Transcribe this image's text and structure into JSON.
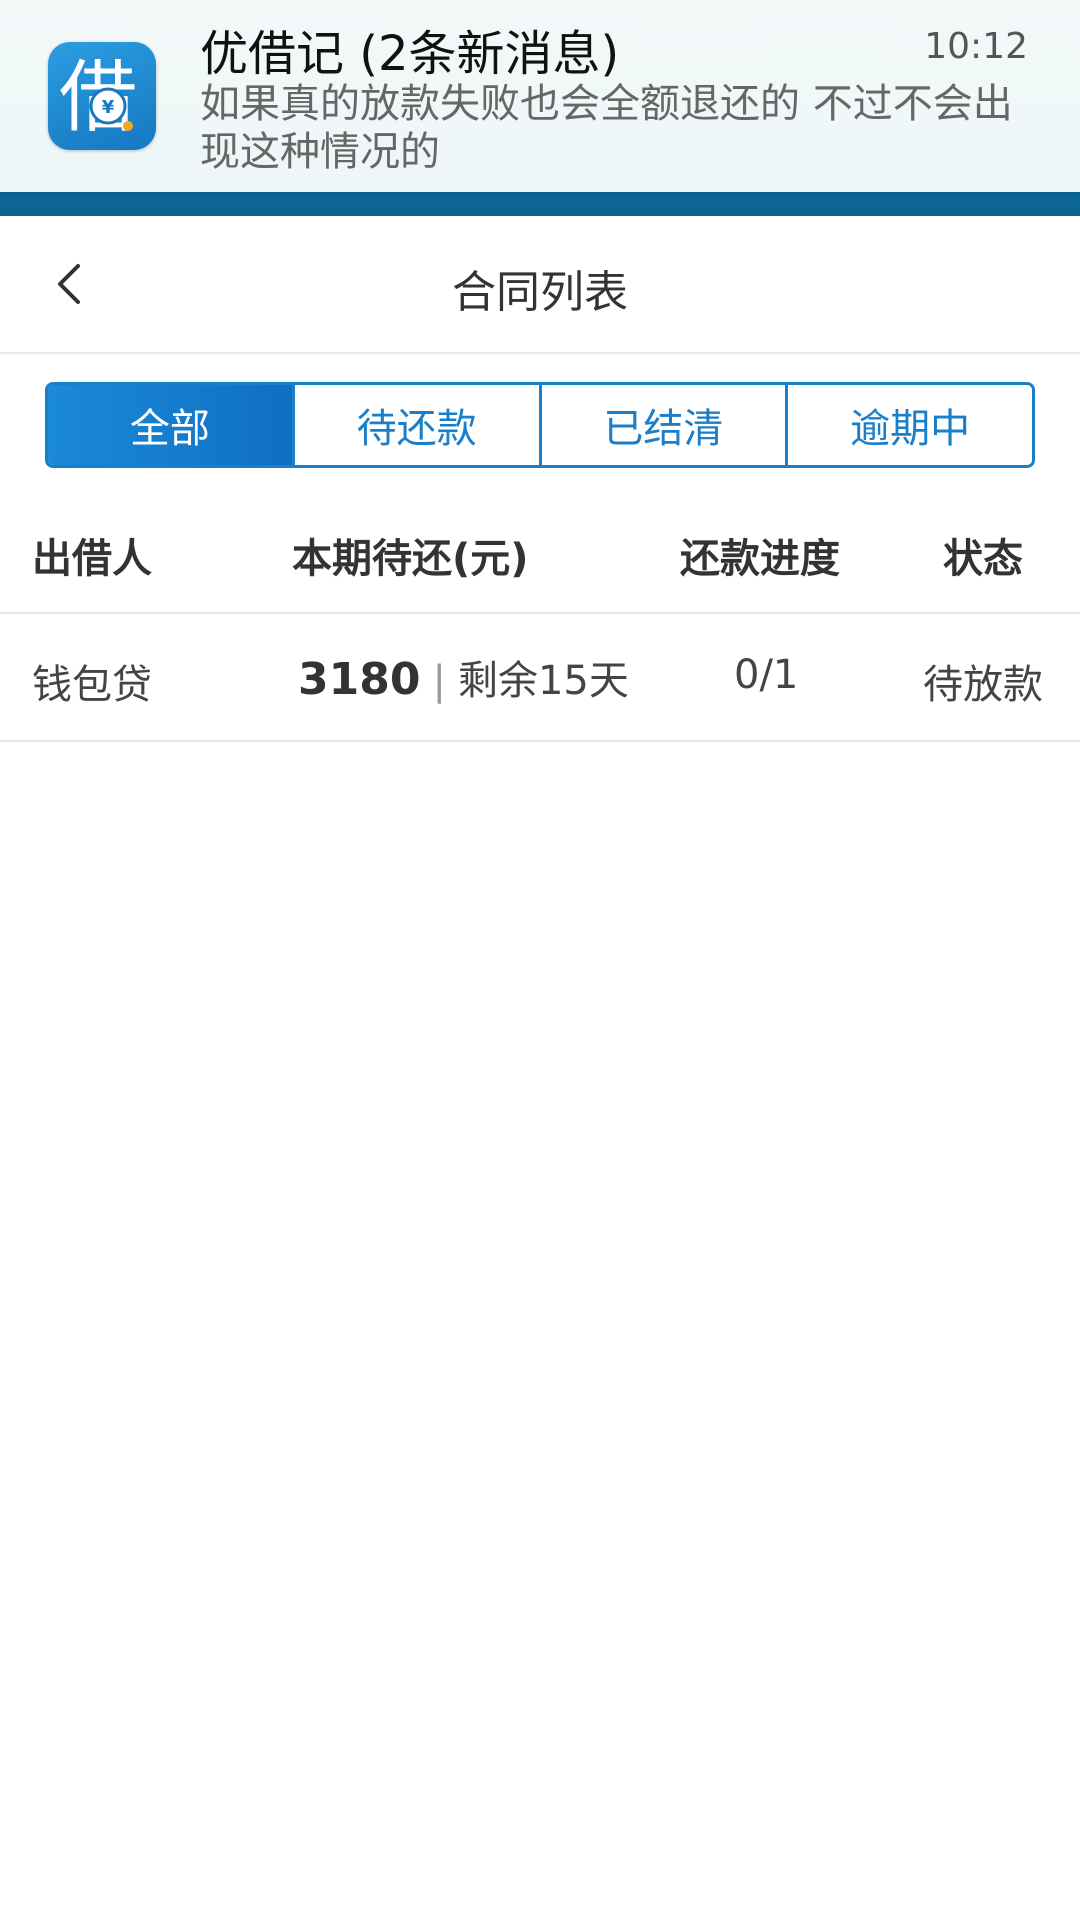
{
  "notification": {
    "app_name_title": "优借记 (2条新消息)",
    "time": "10:12",
    "message": "如果真的放款失败也会全额退还的  不过不会出现这种情况的",
    "icon": "app-logo-jie-icon",
    "icon_glyph": "借",
    "icon_currency": "¥"
  },
  "navbar": {
    "back_icon": "chevron-left-icon",
    "title": "合同列表"
  },
  "tabs": [
    {
      "label": "全部",
      "active": true
    },
    {
      "label": "待还款",
      "active": false
    },
    {
      "label": "已结清",
      "active": false
    },
    {
      "label": "逾期中",
      "active": false
    }
  ],
  "table": {
    "headers": {
      "lender": "出借人",
      "due": "本期待还(元)",
      "progress": "还款进度",
      "status": "状态"
    },
    "rows": [
      {
        "lender": "钱包贷",
        "amount": "3180",
        "separator": "|",
        "remaining": "剩余15天",
        "progress": "0/1",
        "status": "待放款"
      }
    ]
  },
  "colors": {
    "accent": "#1a7fc8",
    "header_blue": "#0f74b3",
    "text_primary": "#333333",
    "divider": "#e3e7eb"
  }
}
